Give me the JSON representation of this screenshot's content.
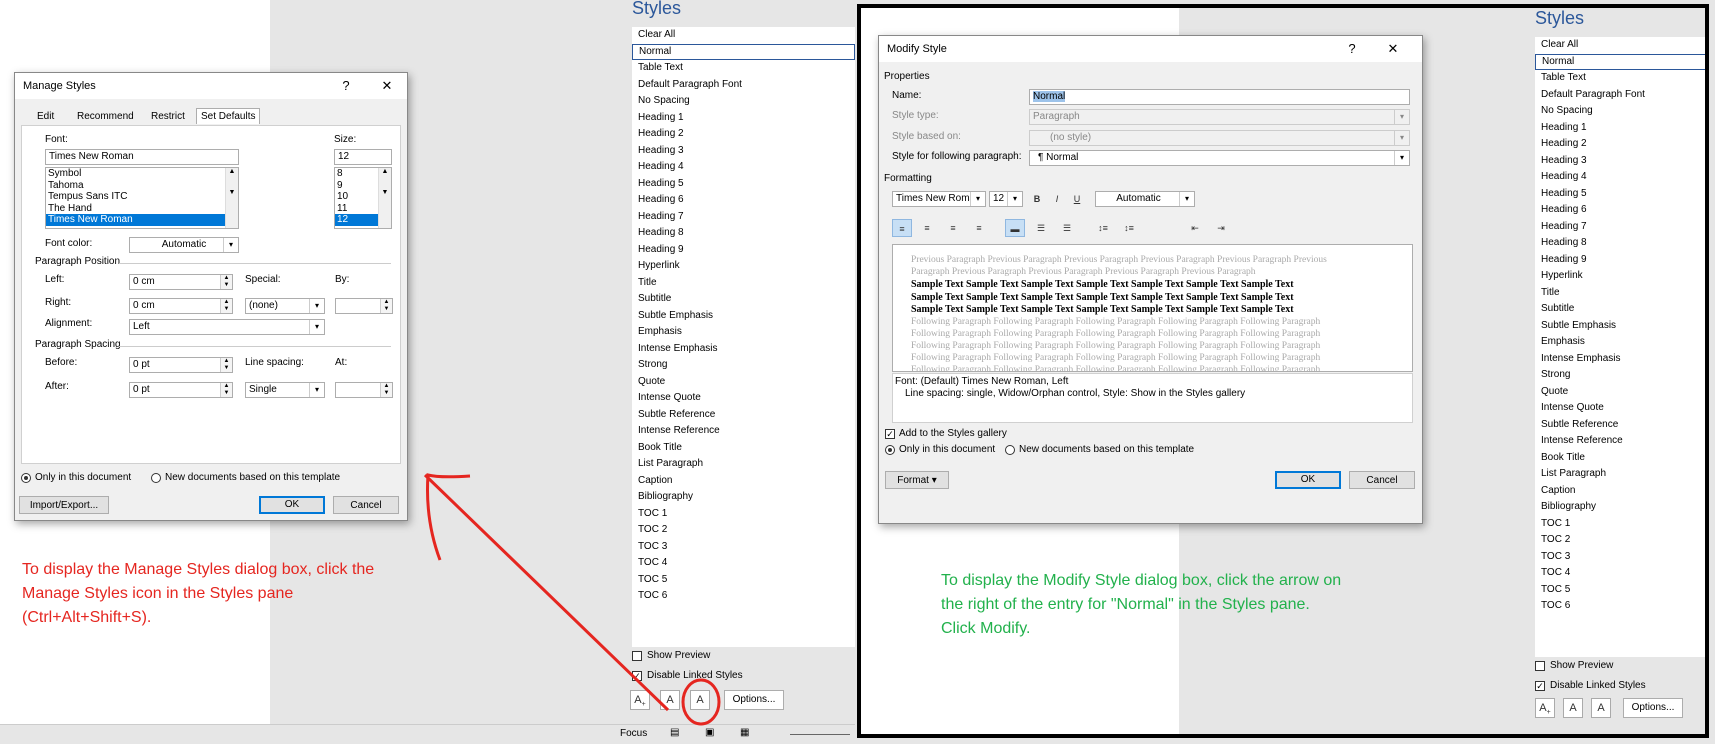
{
  "manage_styles": {
    "title": "Manage Styles",
    "help": "?",
    "close": "✕",
    "tabs": [
      "Edit",
      "Recommend",
      "Restrict",
      "Set Defaults"
    ],
    "font_label": "Font:",
    "font_value": "Times New Roman",
    "font_list": [
      "Symbol",
      "Tahoma",
      "Tempus Sans ITC",
      "The Hand",
      "Times New Roman"
    ],
    "size_label": "Size:",
    "size_value": "12",
    "size_list": [
      "8",
      "9",
      "10",
      "11",
      "12"
    ],
    "font_color_label": "Font color:",
    "font_color_value": "Automatic",
    "para_position_label": "Paragraph Position",
    "left_label": "Left:",
    "left_value": "0 cm",
    "special_label": "Special:",
    "by_label": "By:",
    "right_label": "Right:",
    "right_value": "0 cm",
    "special_value": "(none)",
    "alignment_label": "Alignment:",
    "alignment_value": "Left",
    "para_spacing_label": "Paragraph Spacing",
    "before_label": "Before:",
    "before_value": "0 pt",
    "line_spacing_label": "Line spacing:",
    "at_label": "At:",
    "after_label": "After:",
    "after_value": "0 pt",
    "line_spacing_value": "Single",
    "only_doc": "Only in this document",
    "new_docs": "New documents based on this template",
    "import_export": "Import/Export...",
    "ok": "OK",
    "cancel": "Cancel"
  },
  "styles_pane_left": {
    "title": "Styles",
    "items": [
      "Clear All",
      "Normal",
      "Table Text",
      "Default Paragraph Font",
      "No Spacing",
      "Heading 1",
      "Heading 2",
      "Heading 3",
      "Heading 4",
      "Heading 5",
      "Heading 6",
      "Heading 7",
      "Heading 8",
      "Heading 9",
      "Hyperlink",
      "Title",
      "Subtitle",
      "Subtle Emphasis",
      "Emphasis",
      "Intense Emphasis",
      "Strong",
      "Quote",
      "Intense Quote",
      "Subtle Reference",
      "Intense Reference",
      "Book Title",
      "List Paragraph",
      "Caption",
      "Bibliography",
      "TOC 1",
      "TOC 2",
      "TOC 3",
      "TOC 4",
      "TOC 5",
      "TOC 6"
    ],
    "show_preview": "Show Preview",
    "disable_linked": "Disable Linked Styles",
    "options": "Options..."
  },
  "status_bar": {
    "focus": "Focus"
  },
  "modify_style": {
    "title": "Modify Style",
    "help": "?",
    "close": "✕",
    "properties_label": "Properties",
    "name_label": "Name:",
    "name_value": "Normal",
    "style_type_label": "Style type:",
    "style_type_value": "Paragraph",
    "based_on_label": "Style based on:",
    "based_on_value": "(no style)",
    "following_label": "Style for following paragraph:",
    "following_value": "¶  Normal",
    "formatting_label": "Formatting",
    "font_value": "Times New Roman",
    "size_value": "12",
    "bold": "B",
    "italic": "I",
    "underline": "U",
    "color_value": "Automatic",
    "preview_prev": [
      "Previous Paragraph Previous Paragraph Previous Paragraph Previous Paragraph Previous Paragraph Previous",
      "Paragraph Previous Paragraph Previous Paragraph Previous Paragraph Previous Paragraph"
    ],
    "preview_sample": [
      "Sample Text Sample Text Sample Text Sample Text Sample Text Sample Text Sample Text",
      "Sample Text Sample Text Sample Text Sample Text Sample Text Sample Text Sample Text",
      "Sample Text Sample Text Sample Text Sample Text Sample Text Sample Text Sample Text"
    ],
    "preview_following": [
      "Following Paragraph Following Paragraph Following Paragraph Following Paragraph Following Paragraph",
      "Following Paragraph Following Paragraph Following Paragraph Following Paragraph Following Paragraph",
      "Following Paragraph Following Paragraph Following Paragraph Following Paragraph Following Paragraph",
      "Following Paragraph Following Paragraph Following Paragraph Following Paragraph Following Paragraph",
      "Following Paragraph Following Paragraph Following Paragraph Following Paragraph Following Paragraph"
    ],
    "description_line1": "Font: (Default) Times New Roman, Left",
    "description_line2": "Line spacing:  single, Widow/Orphan control, Style: Show in the Styles gallery",
    "add_gallery": "Add to the Styles gallery",
    "only_doc": "Only in this document",
    "new_docs": "New documents based on this template",
    "format": "Format ▾",
    "ok": "OK",
    "cancel": "Cancel"
  },
  "styles_pane_right": {
    "title": "Styles",
    "items": [
      "Clear All",
      "Normal",
      "Table Text",
      "Default Paragraph Font",
      "No Spacing",
      "Heading 1",
      "Heading 2",
      "Heading 3",
      "Heading 4",
      "Heading 5",
      "Heading 6",
      "Heading 7",
      "Heading 8",
      "Heading 9",
      "Hyperlink",
      "Title",
      "Subtitle",
      "Subtle Emphasis",
      "Emphasis",
      "Intense Emphasis",
      "Strong",
      "Quote",
      "Intense Quote",
      "Subtle Reference",
      "Intense Reference",
      "Book Title",
      "List Paragraph",
      "Caption",
      "Bibliography",
      "TOC 1",
      "TOC 2",
      "TOC 3",
      "TOC 4",
      "TOC 5",
      "TOC 6"
    ],
    "show_preview": "Show Preview",
    "disable_linked": "Disable Linked Styles",
    "options": "Options..."
  },
  "captions": {
    "left": [
      "To display the Manage Styles dialog box, click the",
      "Manage Styles icon in the Styles pane",
      "(Ctrl+Alt+Shift+S)."
    ],
    "right": [
      "To display the Modify Style dialog box, click the arrow on",
      "the right of the entry for \"Normal\" in the Styles pane.",
      "Click Modify."
    ]
  },
  "colors": {
    "red_annotation": "#e52620",
    "green_annotation": "#22b14c",
    "accent_blue": "#2b579a"
  }
}
